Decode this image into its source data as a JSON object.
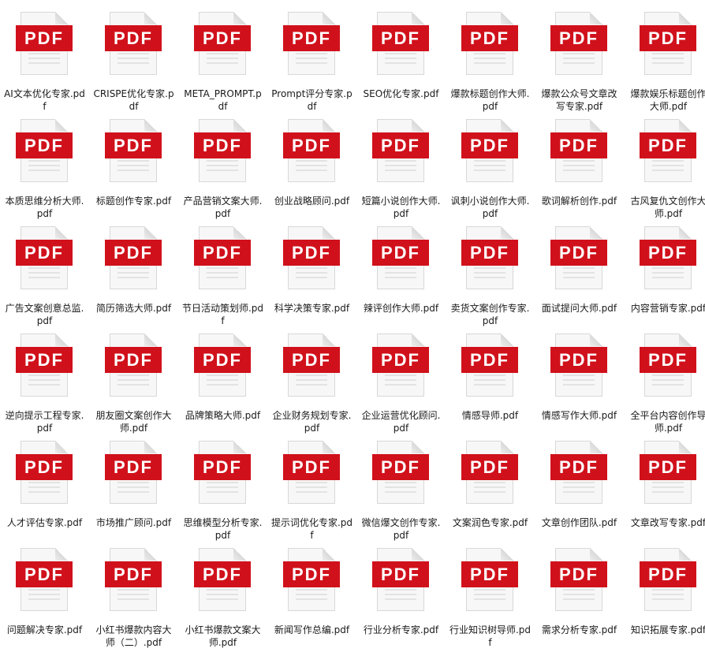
{
  "files": [
    {
      "label": "AI文本优化专家.pdf",
      "badge": "PDF"
    },
    {
      "label": "CRISPE优化专家.pdf",
      "badge": "PDF"
    },
    {
      "label": "META_PROMPT.pdf",
      "badge": "PDF"
    },
    {
      "label": "Prompt评分专家.pdf",
      "badge": "PDF"
    },
    {
      "label": "SEO优化专家.pdf",
      "badge": "PDF"
    },
    {
      "label": "爆款标题创作大师.pdf",
      "badge": "PDF"
    },
    {
      "label": "爆款公众号文章改写专家.pdf",
      "badge": "PDF"
    },
    {
      "label": "爆款娱乐标题创作大师.pdf",
      "badge": "PDF"
    },
    {
      "label": "本质思维分析大师.pdf",
      "badge": "PDF"
    },
    {
      "label": "标题创作专家.pdf",
      "badge": "PDF"
    },
    {
      "label": "产品营销文案大师.pdf",
      "badge": "PDF"
    },
    {
      "label": "创业战略顾问.pdf",
      "badge": "PDF"
    },
    {
      "label": "短篇小说创作大师.pdf",
      "badge": "PDF"
    },
    {
      "label": "讽刺小说创作大师.pdf",
      "badge": "PDF"
    },
    {
      "label": "歌词解析创作.pdf",
      "badge": "PDF"
    },
    {
      "label": "古风复仇文创作大师.pdf",
      "badge": "PDF"
    },
    {
      "label": "广告文案创意总监.pdf",
      "badge": "PDF"
    },
    {
      "label": "简历筛选大师.pdf",
      "badge": "PDF"
    },
    {
      "label": "节日活动策划师.pdf",
      "badge": "PDF"
    },
    {
      "label": "科学决策专家.pdf",
      "badge": "PDF"
    },
    {
      "label": "辣评创作大师.pdf",
      "badge": "PDF"
    },
    {
      "label": "卖货文案创作专家.pdf",
      "badge": "PDF"
    },
    {
      "label": "面试提问大师.pdf",
      "badge": "PDF"
    },
    {
      "label": "内容营销专家.pdf",
      "badge": "PDF"
    },
    {
      "label": "逆向提示工程专家.pdf",
      "badge": "PDF"
    },
    {
      "label": "朋友圈文案创作大师.pdf",
      "badge": "PDF"
    },
    {
      "label": "品牌策略大师.pdf",
      "badge": "PDF"
    },
    {
      "label": "企业财务规划专家.pdf",
      "badge": "PDF"
    },
    {
      "label": "企业运营优化顾问.pdf",
      "badge": "PDF"
    },
    {
      "label": "情感导师.pdf",
      "badge": "PDF"
    },
    {
      "label": "情感写作大师.pdf",
      "badge": "PDF"
    },
    {
      "label": "全平台内容创作导师.pdf",
      "badge": "PDF"
    },
    {
      "label": "人才评估专家.pdf",
      "badge": "PDF"
    },
    {
      "label": "市场推广顾问.pdf",
      "badge": "PDF"
    },
    {
      "label": "思维模型分析专家.pdf",
      "badge": "PDF"
    },
    {
      "label": "提示词优化专家.pdf",
      "badge": "PDF"
    },
    {
      "label": "微信爆文创作专家.pdf",
      "badge": "PDF"
    },
    {
      "label": "文案润色专家.pdf",
      "badge": "PDF"
    },
    {
      "label": "文章创作团队.pdf",
      "badge": "PDF"
    },
    {
      "label": "文章改写专家.pdf",
      "badge": "PDF"
    },
    {
      "label": "问题解决专家.pdf",
      "badge": "PDF"
    },
    {
      "label": "小红书爆款内容大师（二）.pdf",
      "badge": "PDF"
    },
    {
      "label": "小红书爆款文案大师.pdf",
      "badge": "PDF"
    },
    {
      "label": "新闻写作总编.pdf",
      "badge": "PDF"
    },
    {
      "label": "行业分析专家.pdf",
      "badge": "PDF"
    },
    {
      "label": "行业知识树导师.pdf",
      "badge": "PDF"
    },
    {
      "label": "需求分析专家.pdf",
      "badge": "PDF"
    },
    {
      "label": "知识拓展专家.pdf",
      "badge": "PDF"
    }
  ],
  "colors": {
    "badge": "#d0111b",
    "badge_text": "#ffffff",
    "label_text": "#1a1a1a"
  },
  "icons": {
    "file": "pdf-file-icon"
  }
}
